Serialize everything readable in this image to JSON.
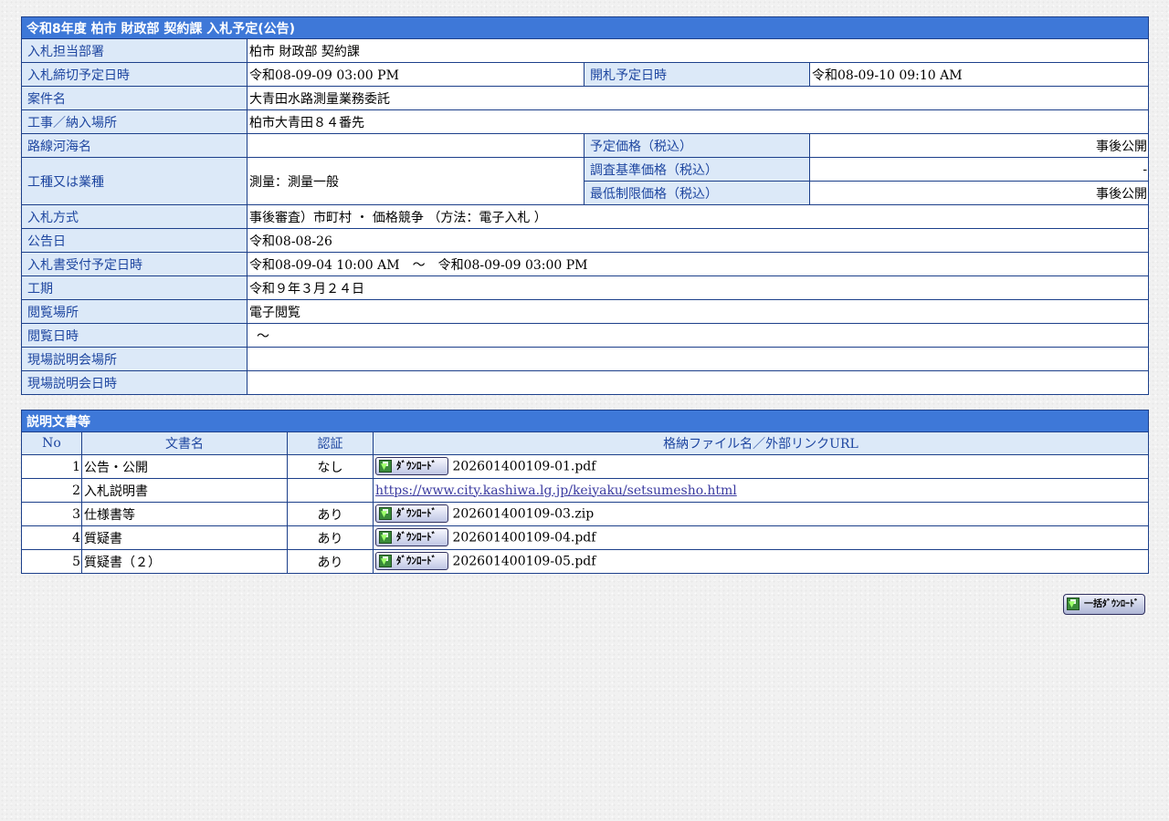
{
  "info": {
    "title": "令和8年度 柏市 財政部 契約課 入札予定(公告)",
    "dept_label": "入札担当部署",
    "dept_value": "柏市 財政部 契約課",
    "deadline_label": "入札締切予定日時",
    "deadline_value": "令和08-09-09 03:00 PM",
    "opening_label": "開札予定日時",
    "opening_value": "令和08-09-10 09:10 AM",
    "case_label": "案件名",
    "case_value": "大青田水路測量業務委託",
    "place_label": "工事／納入場所",
    "place_value": "柏市大青田８４番先",
    "route_label": "路線河海名",
    "route_value": "",
    "planned_price_label": "予定価格（税込）",
    "planned_price_value": "事後公開",
    "type_label": "工種又は業種",
    "type_value": "測量：測量一般",
    "survey_price_label": "調査基準価格（税込）",
    "survey_price_value": "-",
    "min_price_label": "最低制限価格（税込）",
    "min_price_value": "事後公開",
    "method_label": "入札方式",
    "method_value": "事後審査）市町村 ・ 価格競争 （方法：電子入札 ）",
    "notice_date_label": "公告日",
    "notice_date_value": "令和08-08-26",
    "accept_label": "入札書受付予定日時",
    "accept_value": "令和08-09-04 10:00 AM　～　令和08-09-09 03:00 PM",
    "period_label": "工期",
    "period_value": "令和９年３月２４日",
    "view_place_label": "閲覧場所",
    "view_place_value": "電子閲覧",
    "view_date_label": "閲覧日時",
    "view_date_value": "～",
    "site_place_label": "現場説明会場所",
    "site_place_value": "",
    "site_date_label": "現場説明会日時",
    "site_date_value": ""
  },
  "docs": {
    "title": "説明文書等",
    "headers": {
      "no": "No",
      "name": "文書名",
      "auth": "認証",
      "file": "格納ファイル名／外部リンクURL"
    },
    "download_label": "ﾀﾞｳﾝﾛｰﾄﾞ",
    "rows": [
      {
        "no": "1",
        "name": "公告・公開",
        "auth": "なし",
        "file": "202601400109-01.pdf"
      },
      {
        "no": "2",
        "name": "入札説明書",
        "auth": "",
        "file": "https://www.city.kashiwa.lg.jp/keiyaku/setsumesho.html"
      },
      {
        "no": "3",
        "name": "仕様書等",
        "auth": "あり",
        "file": "202601400109-03.zip"
      },
      {
        "no": "4",
        "name": "質疑書",
        "auth": "あり",
        "file": "202601400109-04.pdf"
      },
      {
        "no": "5",
        "name": "質疑書（２）",
        "auth": "あり",
        "file": "202601400109-05.pdf"
      }
    ],
    "bulk_download_label": "一括ﾀﾞｳﾝﾛｰﾄﾞ"
  }
}
